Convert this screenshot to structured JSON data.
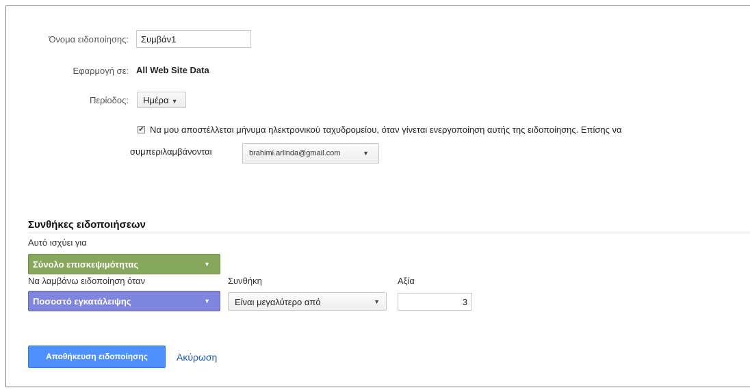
{
  "form": {
    "name_label": "Όνομα ειδοποίησης:",
    "name_value": "Συμβάν1",
    "apply_label": "Εφαρμογή σε:",
    "apply_value": "All Web Site Data",
    "period_label": "Περίοδος:",
    "period_value": "Ημέρα",
    "email_checked": true,
    "email_text_line1": "Να μου αποστέλλεται μήνυμα ηλεκτρονικού ταχυδρομείου, όταν γίνεται ενεργοποίηση αυτής της ειδοποίησης. Επίσης να",
    "email_text_line2": "συμπεριλαμβάνονται",
    "email_selected": "brahimi.arlinda@gmail.com"
  },
  "conditions": {
    "title": "Συνθήκες ειδοποιήσεων",
    "applies_label": "Αυτό ισχύει για",
    "applies_value": "Σύνολο επισκεψιμότητας",
    "alert_when_label": "Να λαμβάνω ειδοποίηση όταν",
    "alert_when_value": "Ποσοστό εγκατάλειψης",
    "condition_label": "Συνθήκη",
    "condition_value": "Είναι μεγαλύτερο από",
    "value_label": "Αξία",
    "value_value": "3"
  },
  "actions": {
    "save_label": "Αποθήκευση ειδοποίησης",
    "cancel_label": "Ακύρωση"
  },
  "colors": {
    "save_button": "#4d90fe",
    "applies_dropdown": "#86a85d",
    "alert_dropdown": "#7e86e0",
    "cancel_link": "#1a56b8"
  },
  "icons": {
    "dropdown": "chevron-down-icon",
    "checkbox": "check-icon"
  }
}
